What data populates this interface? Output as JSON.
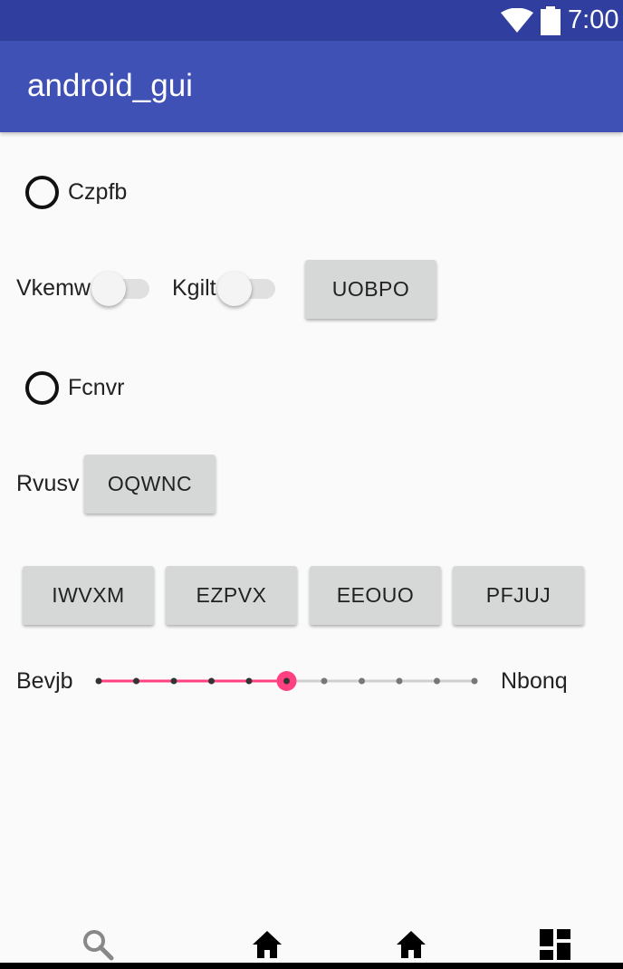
{
  "status_bar": {
    "time": "7:00",
    "icons": [
      "wifi-icon",
      "battery-icon"
    ]
  },
  "app_bar": {
    "title": "android_gui"
  },
  "content": {
    "radio_1": {
      "label": "Czpfb",
      "checked": false
    },
    "switch_1": {
      "label": "Vkemw",
      "on": false
    },
    "switch_2": {
      "label": "Kgilt",
      "on": false
    },
    "button_uobpo": {
      "label": "UOBPO"
    },
    "radio_2": {
      "label": "Fcnvr",
      "checked": false
    },
    "rvusv_label": "Rvusv",
    "button_oqwnc": {
      "label": "OQWNC"
    },
    "button_row": [
      {
        "label": "IWVXM"
      },
      {
        "label": "EZPVX"
      },
      {
        "label": "EEOUO"
      },
      {
        "label": "PFJUJ"
      }
    ],
    "slider": {
      "left_label": "Bevjb",
      "right_label": "Nbonq",
      "value": 5,
      "max": 10,
      "accent_color": "#ff4081"
    }
  },
  "bottom_nav": {
    "icons": [
      "search-icon",
      "home-icon",
      "home-icon",
      "dashboard-icon"
    ]
  },
  "colors": {
    "status_bar": "#303f9f",
    "app_bar": "#3f51b5",
    "background": "#fafafa",
    "button": "#d6d7d7"
  }
}
